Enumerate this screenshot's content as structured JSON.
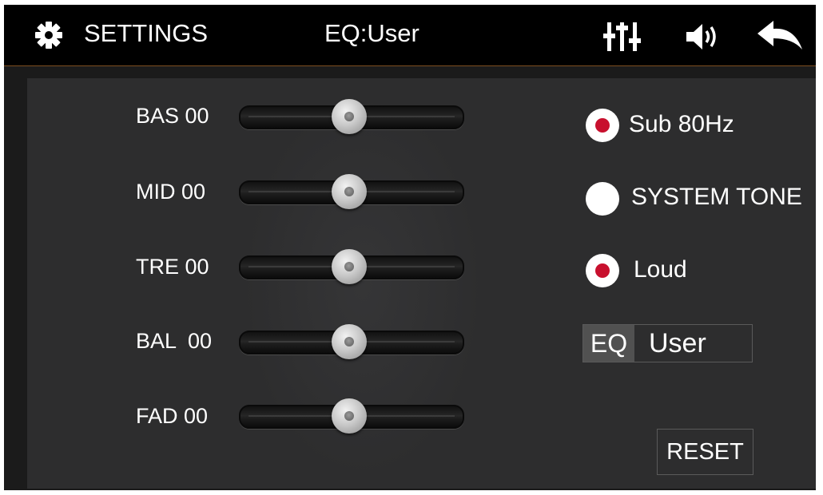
{
  "header": {
    "settings_icon": "gear-icon",
    "settings_label": "SETTINGS",
    "title": "EQ:User",
    "eq_icon": "equalizer-sliders-icon",
    "volume_icon": "speaker-volume-icon",
    "back_icon": "back-arrow-icon"
  },
  "sliders": [
    {
      "label": "BAS 00",
      "value": 0,
      "min": -14,
      "max": 14
    },
    {
      "label": "MID 00",
      "value": 0,
      "min": -14,
      "max": 14
    },
    {
      "label": "TRE 00",
      "value": 0,
      "min": -14,
      "max": 14
    },
    {
      "label": "BAL  00",
      "value": 0,
      "min": -14,
      "max": 14
    },
    {
      "label": "FAD 00",
      "value": 0,
      "min": -14,
      "max": 14
    }
  ],
  "options": [
    {
      "label": "Sub 80Hz",
      "checked": true
    },
    {
      "label": "SYSTEM TONE",
      "checked": false
    },
    {
      "label": "Loud",
      "checked": true
    }
  ],
  "eq": {
    "tag": "EQ",
    "value": "User"
  },
  "reset_label": "RESET",
  "colors": {
    "accent_red": "#c8102e",
    "header_divider": "#7d4d1f",
    "panel": "#2d2d2e"
  }
}
